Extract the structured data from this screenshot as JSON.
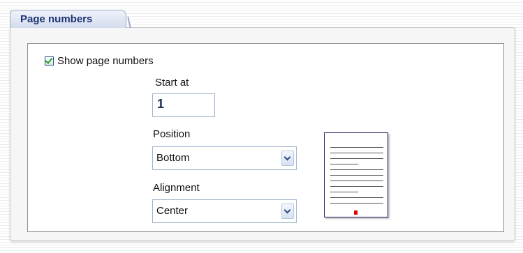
{
  "tab": {
    "label": "Page numbers"
  },
  "show_page_numbers": {
    "label": "Show page numbers",
    "checked": true
  },
  "start_at": {
    "label": "Start at",
    "value": "1"
  },
  "position": {
    "label": "Position",
    "selected": "Bottom"
  },
  "alignment": {
    "label": "Alignment",
    "selected": "Center"
  },
  "preview": {
    "marker_color": "#e00000"
  },
  "colors": {
    "tab_text": "#1e3373",
    "border": "#9fb4cc",
    "check": "#21a121"
  },
  "icons": {
    "checkbox": "checkmark-icon",
    "dropdown": "chevron-down-icon"
  }
}
